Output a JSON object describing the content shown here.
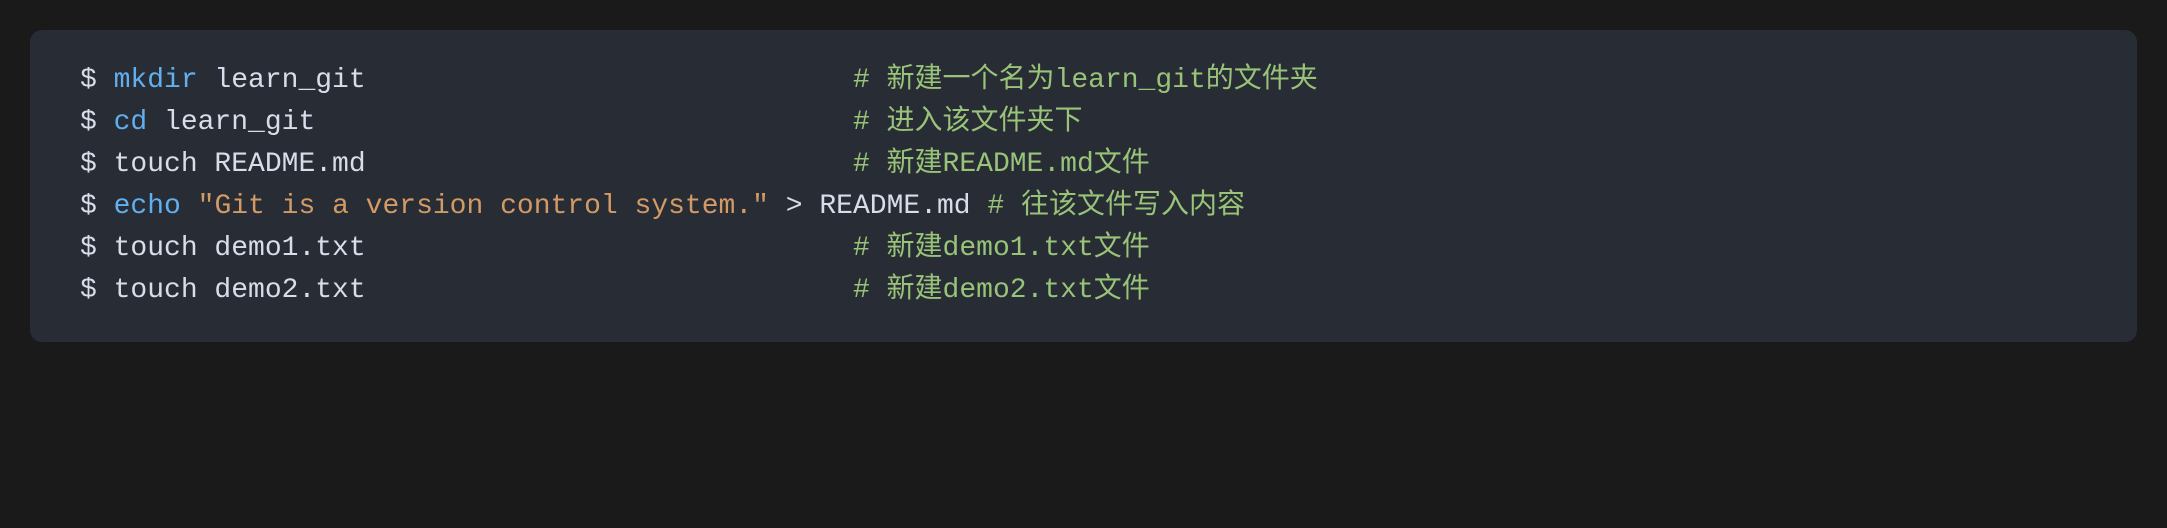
{
  "lines": [
    {
      "prompt": "$ ",
      "tokens": [
        {
          "cls": "builtin",
          "text": "mkdir"
        },
        {
          "cls": "args",
          "text": " learn_git"
        }
      ],
      "comment": "# 新建一个名为learn_git的文件夹"
    },
    {
      "prompt": "$ ",
      "tokens": [
        {
          "cls": "builtin",
          "text": "cd"
        },
        {
          "cls": "args",
          "text": " learn_git"
        }
      ],
      "comment": "# 进入该文件夹下"
    },
    {
      "prompt": "$ ",
      "tokens": [
        {
          "cls": "args",
          "text": "touch README.md"
        }
      ],
      "comment": "# 新建README.md文件"
    },
    {
      "prompt": "$ ",
      "tokens": [
        {
          "cls": "builtin",
          "text": "echo"
        },
        {
          "cls": "args",
          "text": " "
        },
        {
          "cls": "string",
          "text": "\"Git is a version control system.\""
        },
        {
          "cls": "args",
          "text": " "
        },
        {
          "cls": "op",
          "text": ">"
        },
        {
          "cls": "args",
          "text": " "
        },
        {
          "cls": "file",
          "text": "README.md"
        }
      ],
      "comment": "# 往该文件写入内容"
    },
    {
      "prompt": "$ ",
      "tokens": [
        {
          "cls": "args",
          "text": "touch demo1.txt"
        }
      ],
      "comment": "# 新建demo1.txt文件"
    },
    {
      "prompt": "$ ",
      "tokens": [
        {
          "cls": "args",
          "text": "touch demo2.txt"
        }
      ],
      "comment": "# 新建demo2.txt文件"
    }
  ],
  "commentColumn": 46
}
